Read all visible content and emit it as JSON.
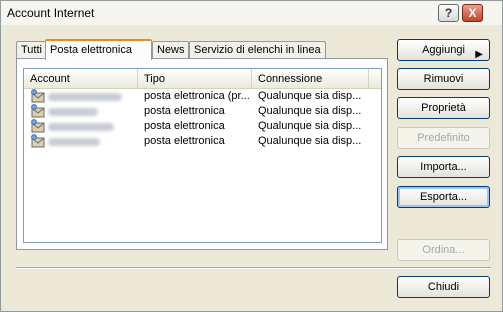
{
  "window": {
    "title": "Account Internet"
  },
  "titlebar": {
    "help": "?",
    "close": "X"
  },
  "tabs": [
    {
      "label": "Tutti",
      "active": false
    },
    {
      "label": "Posta elettronica",
      "active": true
    },
    {
      "label": "News",
      "active": false
    },
    {
      "label": "Servizio di elenchi in linea",
      "active": false
    }
  ],
  "list": {
    "columns": [
      "Account",
      "Tipo",
      "Connessione"
    ],
    "rows": [
      {
        "tipo": "posta elettronica (pr...",
        "connessione": "Qualunque sia disp..."
      },
      {
        "tipo": "posta elettronica",
        "connessione": "Qualunque sia disp..."
      },
      {
        "tipo": "posta elettronica",
        "connessione": "Qualunque sia disp..."
      },
      {
        "tipo": "posta elettronica",
        "connessione": "Qualunque sia disp..."
      }
    ]
  },
  "buttons": {
    "aggiungi": "Aggiungi",
    "rimuovi": "Rimuovi",
    "proprieta": "Proprietà",
    "predefinito": "Predefinito",
    "importa": "Importa...",
    "esporta": "Esporta...",
    "ordina": "Ordina...",
    "chiudi": "Chiudi"
  },
  "icons": {
    "account": "mail-account-icon",
    "submenu": "triangle-right-icon"
  },
  "colors": {
    "tab_highlight": "#e68b2c",
    "window_bg": "#ece9d8"
  }
}
